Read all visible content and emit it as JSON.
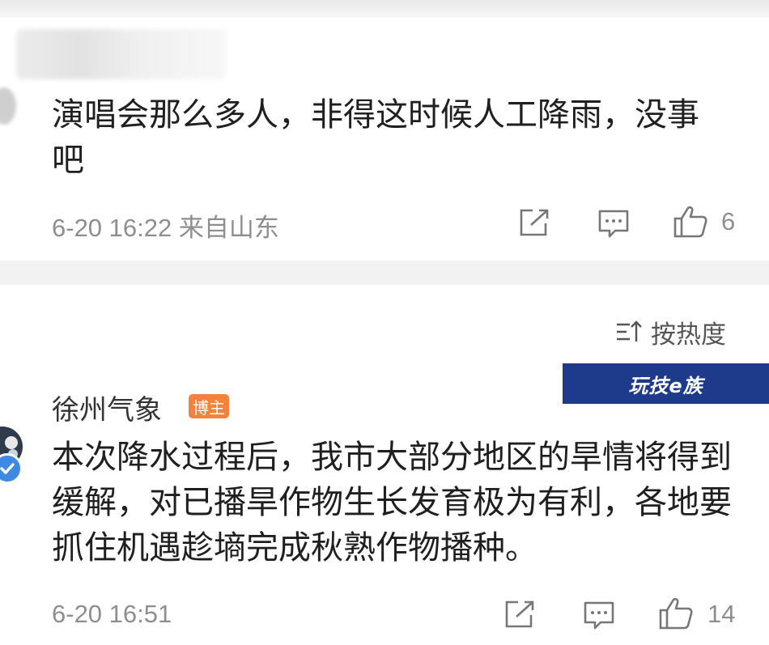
{
  "comment1": {
    "text": "演唱会那么多人，非得这时候人工降雨，没事吧",
    "meta": "6-20 16:22 来自山东",
    "likes": "6"
  },
  "sort": {
    "label": "按热度",
    "icon": "sort-icon"
  },
  "watermark": {
    "text": "玩技e族"
  },
  "comment2": {
    "author": "徐州气象",
    "badge": "博主",
    "text": "本次降水过程后，我市大部分地区的旱情将得到缓解，对已播旱作物生长发育极为有利，各地要抓住机遇趁墒完成秋熟作物播种。",
    "meta": "6-20 16:51",
    "likes": "14"
  },
  "icons": {
    "share": "share-icon",
    "reply": "comment-icon",
    "like": "thumbs-up-icon",
    "verified": "verified-icon"
  },
  "colors": {
    "meta_gray": "#8e8e8e",
    "badge_orange": "#f3823a",
    "verified_blue": "#3f8ae0",
    "watermark_blue": "#1e3a8a"
  }
}
